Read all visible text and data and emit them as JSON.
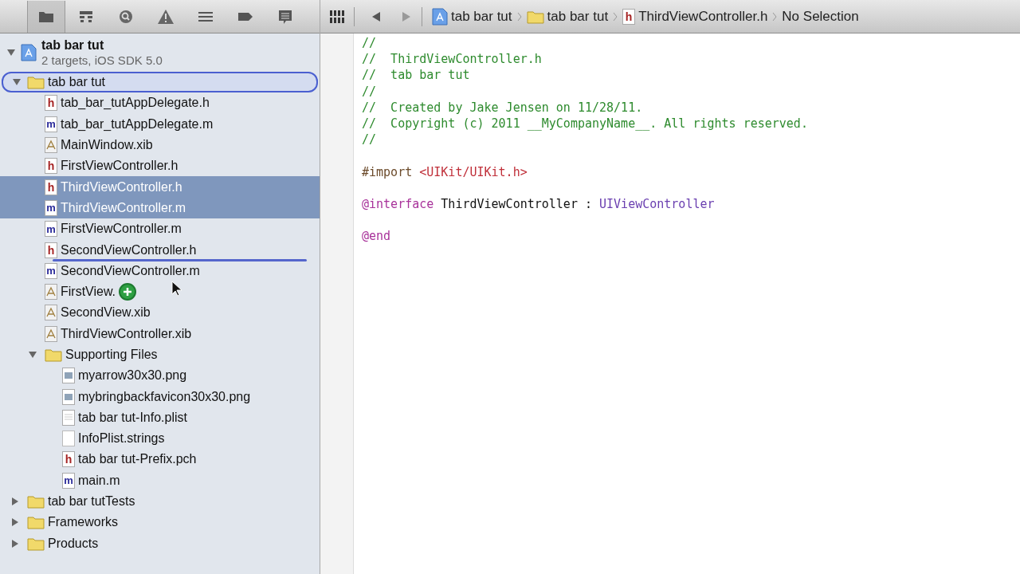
{
  "navigator_tabs": [
    {
      "selected": true
    },
    {
      "selected": false
    },
    {
      "selected": false
    },
    {
      "selected": false
    },
    {
      "selected": false
    },
    {
      "selected": false
    },
    {
      "selected": false
    }
  ],
  "jump_bar": {
    "items": [
      {
        "kind": "project",
        "label": "tab bar tut"
      },
      {
        "kind": "folder",
        "label": "tab bar tut"
      },
      {
        "kind": "header",
        "icon_letter": "h",
        "label": "ThirdViewController.h"
      },
      {
        "kind": "text",
        "label": "No Selection"
      }
    ]
  },
  "project": {
    "name": "tab bar tut",
    "subtitle": "2 targets, iOS SDK 5.0",
    "expanded": true,
    "children": [
      {
        "kind": "folder",
        "label": "tab bar tut",
        "expanded": true,
        "drop_target": true,
        "selected": false,
        "children": [
          {
            "kind": "header",
            "icon_letter": "h",
            "label": "tab_bar_tutAppDelegate.h",
            "selected": false
          },
          {
            "kind": "source",
            "icon_letter": "m",
            "label": "tab_bar_tutAppDelegate.m",
            "selected": false
          },
          {
            "kind": "interface",
            "label": "MainWindow.xib",
            "selected": false
          },
          {
            "kind": "header",
            "icon_letter": "h",
            "label": "FirstViewController.h",
            "selected": false
          },
          {
            "kind": "header",
            "icon_letter": "h",
            "label": "ThirdViewController.h",
            "selected": true
          },
          {
            "kind": "source",
            "icon_letter": "m",
            "label": "ThirdViewController.m",
            "selected": true
          },
          {
            "kind": "source",
            "icon_letter": "m",
            "label": "FirstViewController.m",
            "selected": false
          },
          {
            "kind": "header",
            "icon_letter": "h",
            "label": "SecondViewController.h",
            "selected": false,
            "drop_line_below": true
          },
          {
            "kind": "source",
            "icon_letter": "m",
            "label": "SecondViewController.m",
            "selected": false
          },
          {
            "kind": "interface",
            "label": "FirstView.",
            "selected": false,
            "copy_badge": true
          },
          {
            "kind": "interface",
            "label": "SecondView.xib",
            "selected": false
          },
          {
            "kind": "interface",
            "label": "ThirdViewController.xib",
            "selected": false
          },
          {
            "kind": "folder",
            "label": "Supporting Files",
            "expanded": true,
            "selected": false,
            "children": [
              {
                "kind": "image",
                "label": "myarrow30x30.png",
                "selected": false
              },
              {
                "kind": "image",
                "label": "mybringbackfavicon30x30.png",
                "selected": false
              },
              {
                "kind": "plist",
                "label": "tab bar tut-Info.plist",
                "selected": false
              },
              {
                "kind": "strings",
                "label": "InfoPlist.strings",
                "selected": false
              },
              {
                "kind": "header",
                "icon_letter": "h",
                "label": "tab bar tut-Prefix.pch",
                "selected": false
              },
              {
                "kind": "source",
                "icon_letter": "m",
                "label": "main.m",
                "selected": false
              }
            ]
          }
        ]
      },
      {
        "kind": "folder",
        "label": "tab bar tutTests",
        "expanded": false,
        "selected": false
      },
      {
        "kind": "folder",
        "label": "Frameworks",
        "expanded": false,
        "selected": false
      },
      {
        "kind": "folder",
        "label": "Products",
        "expanded": false,
        "selected": false
      }
    ]
  },
  "code_lines": [
    {
      "kind": "code",
      "tokens": [
        {
          "kind": "comment",
          "text": "//"
        }
      ]
    },
    {
      "kind": "code",
      "tokens": [
        {
          "kind": "comment",
          "text": "//  ThirdViewController.h"
        }
      ]
    },
    {
      "kind": "code",
      "tokens": [
        {
          "kind": "comment",
          "text": "//  tab bar tut"
        }
      ]
    },
    {
      "kind": "code",
      "tokens": [
        {
          "kind": "comment",
          "text": "//"
        }
      ]
    },
    {
      "kind": "code",
      "tokens": [
        {
          "kind": "comment",
          "text": "//  Created by Jake Jensen on 11/28/11."
        }
      ]
    },
    {
      "kind": "code",
      "tokens": [
        {
          "kind": "comment",
          "text": "//  Copyright (c) 2011 __MyCompanyName__. All rights reserved."
        }
      ]
    },
    {
      "kind": "code",
      "tokens": [
        {
          "kind": "comment",
          "text": "//"
        }
      ]
    },
    {
      "kind": "blank"
    },
    {
      "kind": "code",
      "tokens": [
        {
          "kind": "preprocessor",
          "text": "#import "
        },
        {
          "kind": "string",
          "text": "<UIKit/UIKit.h>"
        }
      ]
    },
    {
      "kind": "blank"
    },
    {
      "kind": "code",
      "tokens": [
        {
          "kind": "keyword",
          "text": "@interface"
        },
        {
          "kind": "plain",
          "text": " ThirdViewController : "
        },
        {
          "kind": "class",
          "text": "UIViewController"
        }
      ]
    },
    {
      "kind": "blank"
    },
    {
      "kind": "code",
      "tokens": [
        {
          "kind": "keyword",
          "text": "@end"
        }
      ]
    }
  ]
}
